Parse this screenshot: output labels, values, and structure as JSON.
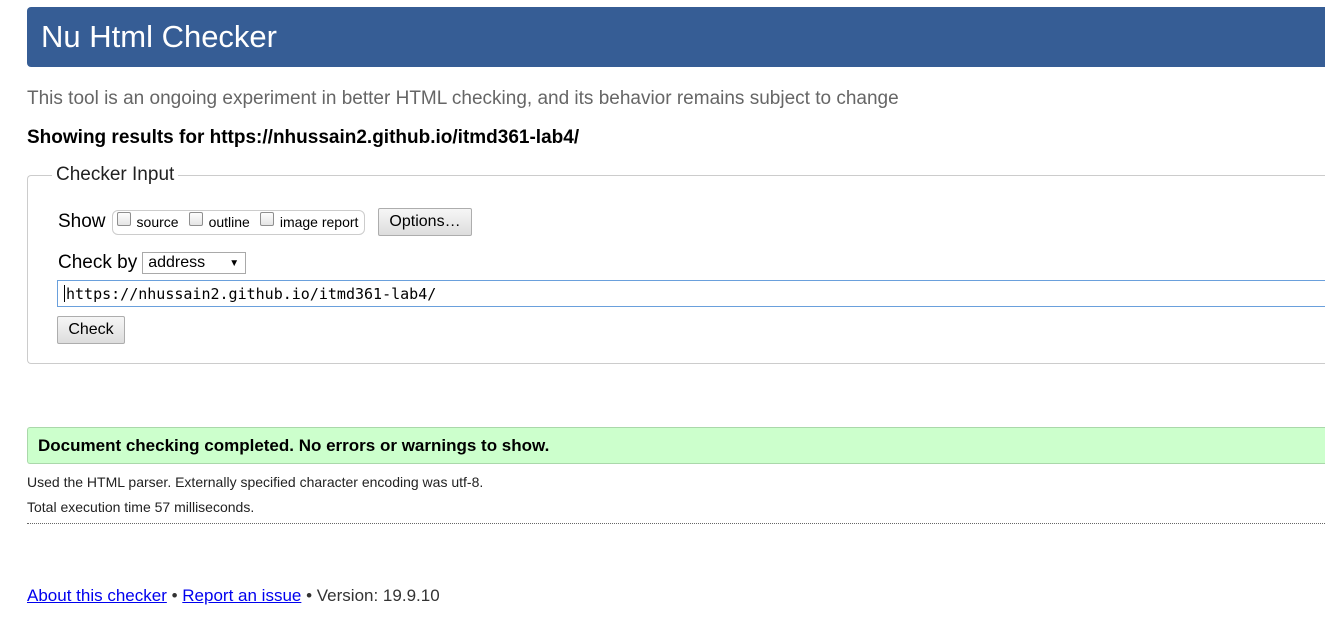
{
  "header": {
    "title": "Nu Html Checker"
  },
  "intro": {
    "subtitle": "This tool is an ongoing experiment in better HTML checking, and its behavior remains subject to change",
    "results_for": "Showing results for https://nhussain2.github.io/itmd361-lab4/"
  },
  "checker_input": {
    "legend": "Checker Input",
    "show_label": "Show",
    "show_options": [
      {
        "label": "source",
        "checked": false
      },
      {
        "label": "outline",
        "checked": false
      },
      {
        "label": "image report",
        "checked": false
      }
    ],
    "options_button": "Options…",
    "check_by_label": "Check by",
    "check_by_selected": "address",
    "url_value": "https://nhussain2.github.io/itmd361-lab4/",
    "check_button": "Check"
  },
  "results": {
    "success_message": "Document checking completed. No errors or warnings to show.",
    "parser_info": "Used the HTML parser. Externally specified character encoding was utf-8.",
    "execution_time": "Total execution time 57 milliseconds."
  },
  "footer": {
    "about_link": "About this checker",
    "separator": "•",
    "report_link": "Report an issue",
    "version": "Version: 19.9.10"
  },
  "colors": {
    "header_bg": "#365d95",
    "success_bg": "#ccffcc",
    "link": "#0000ee"
  }
}
